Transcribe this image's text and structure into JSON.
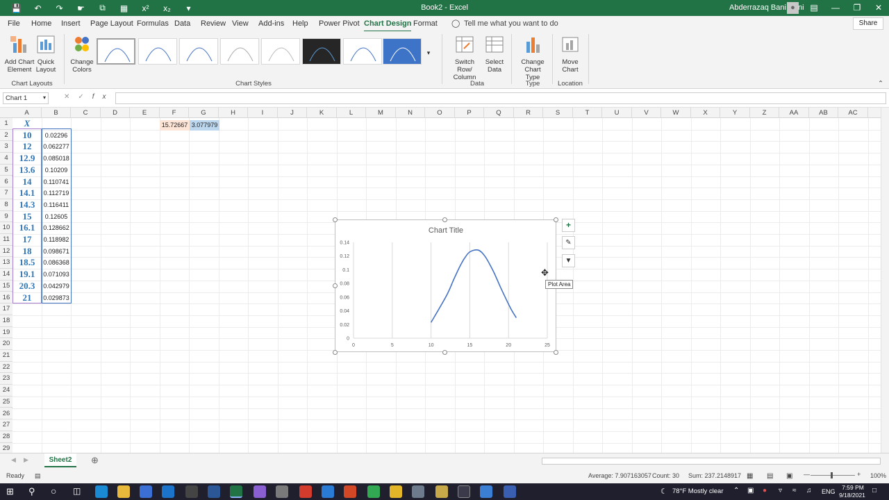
{
  "titlebar": {
    "doc": "Book2 - Excel",
    "user": "Abderrazaq Bani Hani"
  },
  "tabs": [
    "File",
    "Home",
    "Insert",
    "Page Layout",
    "Formulas",
    "Data",
    "Review",
    "View",
    "Add-ins",
    "Help",
    "Power Pivot",
    "Chart Design",
    "Format"
  ],
  "tell": "Tell me what you want to do",
  "share": "Share",
  "ribbon": {
    "add_chart_element": "Add Chart Element",
    "quick_layout": "Quick Layout",
    "change_colors": "Change Colors",
    "switch_row": "Switch Row/ Column",
    "select_data": "Select Data",
    "change_type": "Change Chart Type",
    "move_chart": "Move Chart",
    "groups": {
      "layouts": "Chart Layouts",
      "styles": "Chart Styles",
      "data": "Data",
      "type": "Type",
      "location": "Location"
    }
  },
  "namebox": "Chart 1",
  "columns": [
    "A",
    "B",
    "C",
    "D",
    "E",
    "F",
    "G",
    "H",
    "I",
    "J",
    "K",
    "L",
    "M",
    "N",
    "O",
    "P",
    "Q",
    "R",
    "S",
    "T",
    "U",
    "V",
    "W",
    "X",
    "Y",
    "Z",
    "AA",
    "AB",
    "AC"
  ],
  "cells": {
    "a_header": "X",
    "x": [
      "10",
      "12",
      "12.9",
      "13.6",
      "14",
      "14.1",
      "14.3",
      "15",
      "16.1",
      "17",
      "18",
      "18.5",
      "19.1",
      "20.3",
      "21"
    ],
    "y": [
      "0.02296",
      "0.062277",
      "0.085018",
      "0.10209",
      "0.110741",
      "0.112719",
      "0.116411",
      "0.12605",
      "0.128662",
      "0.118982",
      "0.098671",
      "0.086368",
      "0.071093",
      "0.042979",
      "0.029873"
    ],
    "f1": "15.72667",
    "g1": "3.077979"
  },
  "chart_data": {
    "type": "scatter",
    "title": "Chart Title",
    "x": [
      10,
      12,
      12.9,
      13.6,
      14,
      14.1,
      14.3,
      15,
      16.1,
      17,
      18,
      18.5,
      19.1,
      20.3,
      21
    ],
    "y": [
      0.02296,
      0.062277,
      0.085018,
      0.10209,
      0.110741,
      0.112719,
      0.116411,
      0.12605,
      0.128662,
      0.118982,
      0.098671,
      0.086368,
      0.071093,
      0.042979,
      0.029873
    ],
    "xlim": [
      0,
      25
    ],
    "ylim": [
      0,
      0.14
    ],
    "xticks": [
      "0",
      "5",
      "10",
      "15",
      "20",
      "25"
    ],
    "yticks": [
      "0",
      "0.02",
      "0.04",
      "0.06",
      "0.08",
      "0.1",
      "0.12",
      "0.14"
    ],
    "line_color": "#4472c4",
    "grid": "vertical"
  },
  "tooltip": "Plot Area",
  "sheet": "Sheet2",
  "status": {
    "ready": "Ready",
    "average": "Average: 7.907163057",
    "count": "Count: 30",
    "sum": "Sum: 237.2148917",
    "zoom": "100%"
  },
  "taskbar": {
    "weather": "78°F  Mostly clear",
    "lang": "ENG",
    "time": "7:59 PM",
    "date": "9/18/2021"
  }
}
